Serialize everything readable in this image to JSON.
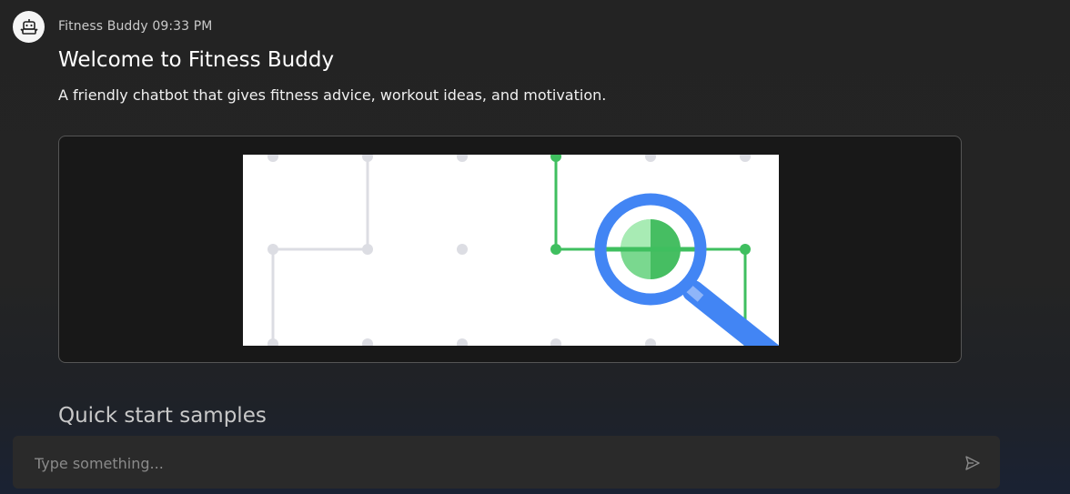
{
  "message": {
    "sender": "Fitness Buddy",
    "time": "09:33 PM",
    "meta_text": "Fitness Buddy 09:33 PM",
    "avatar_icon": "robot-icon",
    "title": "Welcome to Fitness Buddy",
    "description": "A friendly chatbot that gives fitness advice, workout ideas, and motivation.",
    "illustration_icon": "magnifier-network-illustration"
  },
  "quick_start": {
    "heading": "Quick start samples"
  },
  "composer": {
    "placeholder": "Type something...",
    "send_icon": "send-icon"
  },
  "colors": {
    "accent_blue": "#4285f4",
    "accent_green": "#3fbf5f",
    "background": "#232323"
  }
}
